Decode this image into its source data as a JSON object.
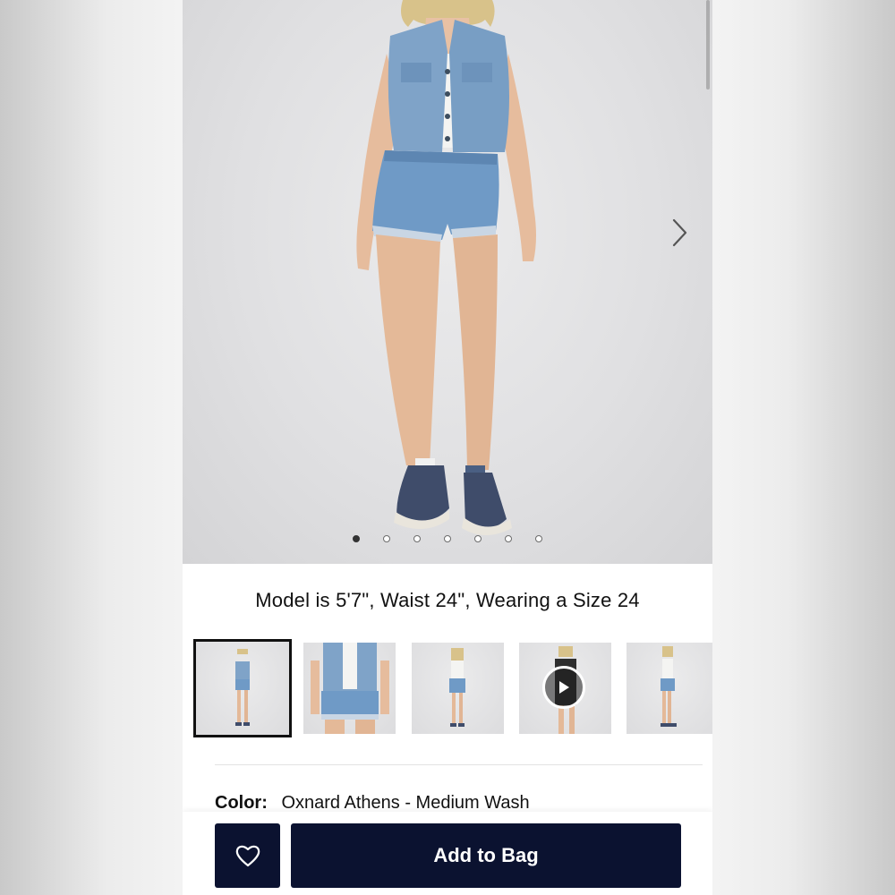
{
  "product": {
    "gallery": {
      "dot_count": 7,
      "active_dot_index": 0
    },
    "model_info": "Model is 5'7\", Waist 24\", Wearing a Size 24",
    "thumbnails": [
      {
        "kind": "front-full"
      },
      {
        "kind": "detail-closeup"
      },
      {
        "kind": "back-full"
      },
      {
        "kind": "video"
      },
      {
        "kind": "side-full"
      }
    ],
    "color": {
      "label": "Color:",
      "value": "Oxnard Athens - Medium Wash"
    }
  },
  "actions": {
    "add_to_bag": "Add to Bag"
  },
  "icons": {
    "next": "chevron-right-icon",
    "wishlist": "heart-icon",
    "video": "play-icon"
  },
  "colors": {
    "primary_button": "#0b1230",
    "text": "#111111"
  }
}
